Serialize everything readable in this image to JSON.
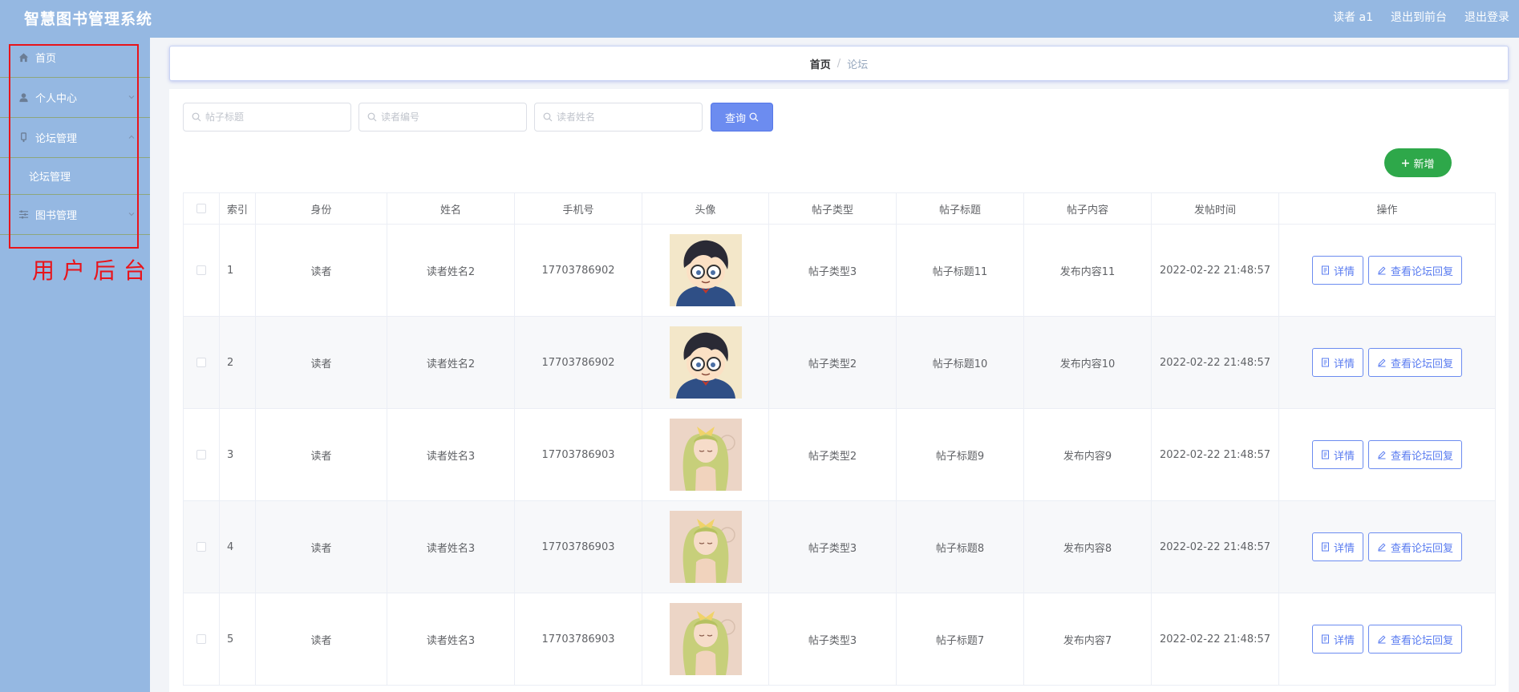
{
  "app": {
    "title": "智慧图书管理系统"
  },
  "header": {
    "user_label": "读者 a1",
    "to_front_label": "退出到前台",
    "logout_label": "退出登录"
  },
  "sidebar": {
    "items": [
      {
        "label": "首页",
        "icon": "home-icon"
      },
      {
        "label": "个人中心",
        "icon": "user-icon",
        "expandable": true
      },
      {
        "label": "论坛管理",
        "icon": "forum-icon",
        "expandable": true,
        "expanded": true,
        "children": [
          "论坛管理"
        ]
      },
      {
        "label": "图书管理",
        "icon": "settings-icon",
        "expandable": true
      }
    ],
    "annotation_label": "用户后台"
  },
  "breadcrumb": {
    "home": "首页",
    "separator": "/",
    "current": "论坛"
  },
  "search": {
    "title_placeholder": "帖子标题",
    "reader_id_placeholder": "读者编号",
    "reader_name_placeholder": "读者姓名",
    "query_label": "查询",
    "add_label": "新增"
  },
  "table": {
    "columns": [
      "索引",
      "身份",
      "姓名",
      "手机号",
      "头像",
      "帖子类型",
      "帖子标题",
      "帖子内容",
      "发帖时间",
      "操作"
    ],
    "detail_label": "详情",
    "view_replies_label": "查看论坛回复",
    "rows": [
      {
        "index": "1",
        "identity": "读者",
        "name": "读者姓名2",
        "phone": "17703786902",
        "avatar": "conan",
        "type": "帖子类型3",
        "title": "帖子标题11",
        "content": "发布内容11",
        "time": "2022-02-22 21:48:57"
      },
      {
        "index": "2",
        "identity": "读者",
        "name": "读者姓名2",
        "phone": "17703786902",
        "avatar": "conan",
        "type": "帖子类型2",
        "title": "帖子标题10",
        "content": "发布内容10",
        "time": "2022-02-22 21:48:57"
      },
      {
        "index": "3",
        "identity": "读者",
        "name": "读者姓名3",
        "phone": "17703786903",
        "avatar": "girl",
        "type": "帖子类型2",
        "title": "帖子标题9",
        "content": "发布内容9",
        "time": "2022-02-22 21:48:57"
      },
      {
        "index": "4",
        "identity": "读者",
        "name": "读者姓名3",
        "phone": "17703786903",
        "avatar": "girl",
        "type": "帖子类型3",
        "title": "帖子标题8",
        "content": "发布内容8",
        "time": "2022-02-22 21:48:57"
      },
      {
        "index": "5",
        "identity": "读者",
        "name": "读者姓名3",
        "phone": "17703786903",
        "avatar": "girl",
        "type": "帖子类型3",
        "title": "帖子标题7",
        "content": "发布内容7",
        "time": "2022-02-22 21:48:57"
      }
    ]
  },
  "colors": {
    "header_bg": "#95b8e2",
    "primary": "#6c8cf0",
    "success": "#2ea84a",
    "annotation": "#e8141b"
  }
}
